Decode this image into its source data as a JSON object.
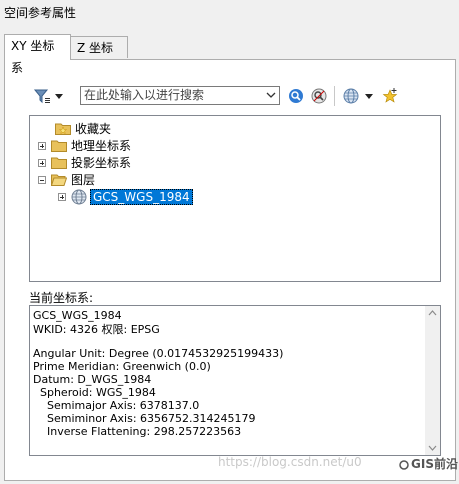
{
  "window": {
    "title": "空间参考属性"
  },
  "tabs": [
    {
      "label": "XY 坐标系",
      "active": true
    },
    {
      "label": "Z 坐标系",
      "active": false
    }
  ],
  "toolbar": {
    "search_placeholder": "在此处输入以进行搜索"
  },
  "tree": {
    "items": [
      {
        "label": "收藏夹",
        "expander": "none"
      },
      {
        "label": "地理坐标系",
        "expander": "plus"
      },
      {
        "label": "投影坐标系",
        "expander": "plus"
      },
      {
        "label": "图层",
        "expander": "minus"
      },
      {
        "label": "GCS_WGS_1984",
        "expander": "plus",
        "selected": true
      }
    ]
  },
  "current": {
    "label": "当前坐标系:",
    "lines": [
      "GCS_WGS_1984",
      "WKID: 4326 权限: EPSG",
      "",
      "Angular Unit: Degree (0.0174532925199433)",
      "Prime Meridian: Greenwich (0.0)",
      "Datum: D_WGS_1984",
      "  Spheroid: WGS_1984",
      "    Semimajor Axis: 6378137.0",
      "    Semiminor Axis: 6356752.314245179",
      "    Inverse Flattening: 298.257223563"
    ]
  },
  "watermark": {
    "text": "https://blog.csdn.net/u0",
    "brand": "GIS前沿"
  },
  "colors": {
    "selection": "#0078d7",
    "folder": "#e8c15b"
  }
}
